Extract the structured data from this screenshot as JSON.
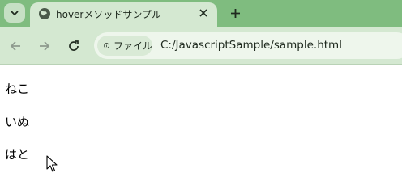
{
  "browser": {
    "tab": {
      "title": "hoverメソッドサンプル"
    },
    "address_bar": {
      "site_chip_label": "ファイル",
      "url": "C:/JavascriptSample/sample.html"
    }
  },
  "page": {
    "items": [
      "ねこ",
      "いぬ",
      "はと"
    ]
  },
  "icons": {
    "tab_search": "chevron-down-icon",
    "favicon": "globe-icon",
    "close": "close-icon",
    "new_tab": "plus-icon",
    "back": "arrow-left-icon",
    "forward": "arrow-right-icon",
    "reload": "reload-icon",
    "info": "info-icon",
    "cursor": "mouse-pointer-icon"
  },
  "colors": {
    "tabstrip": "#7fbc7f",
    "toolbar": "#d4e8d1",
    "omnibox": "#eef6ec"
  }
}
